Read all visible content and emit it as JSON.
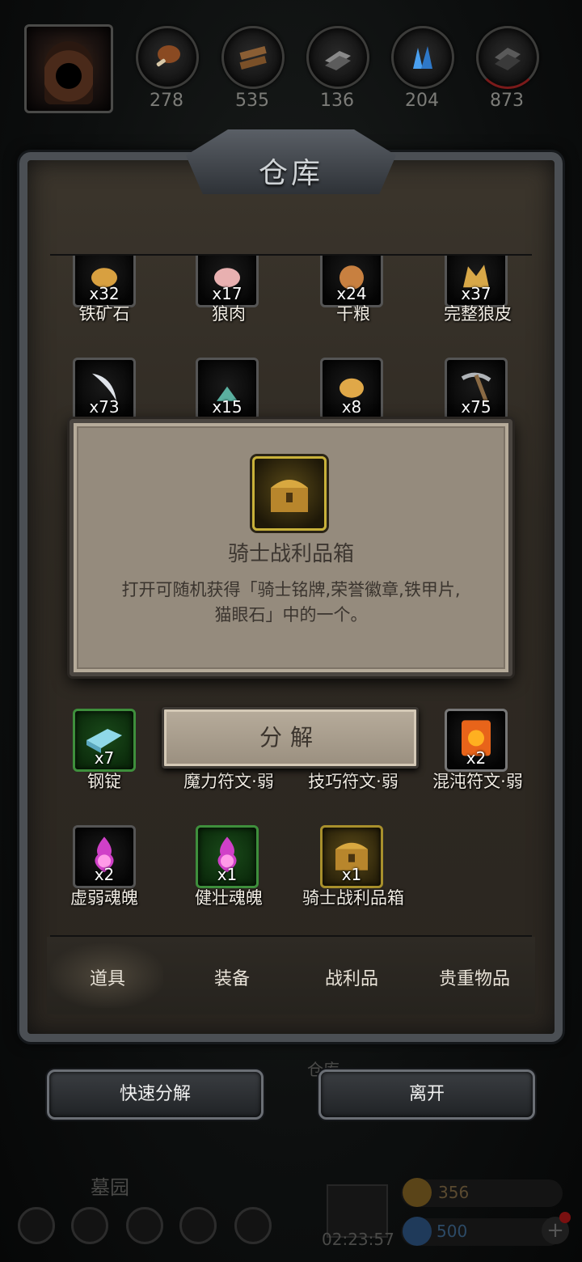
{
  "resources": [
    {
      "name": "meat-icon",
      "value": "278",
      "color": "#8a4a22"
    },
    {
      "name": "wood-icon",
      "value": "535",
      "color": "#8a5e34"
    },
    {
      "name": "iron-icon",
      "value": "136",
      "color": "#7a7a7a"
    },
    {
      "name": "crystal-icon",
      "value": "204",
      "color": "#3a8ad8"
    },
    {
      "name": "ore-icon",
      "value": "873",
      "color": "#5a5a5a"
    }
  ],
  "panel": {
    "title": "仓库"
  },
  "items_row1": [
    {
      "qty": "x32",
      "label": "铁矿石"
    },
    {
      "qty": "x17",
      "label": "狼肉"
    },
    {
      "qty": "x24",
      "label": "干粮"
    },
    {
      "qty": "x37",
      "label": "完整狼皮"
    }
  ],
  "items_row2": [
    {
      "qty": "x73"
    },
    {
      "qty": "x15"
    },
    {
      "qty": "x8"
    },
    {
      "qty": "x75"
    }
  ],
  "items_row3": [
    {
      "qty": "x7",
      "label": "钢锭"
    },
    {
      "label": "魔力符文·弱"
    },
    {
      "label": "技巧符文·弱"
    },
    {
      "qty": "x2",
      "label": "混沌符文·弱"
    }
  ],
  "items_row4": [
    {
      "qty": "x2",
      "label": "虚弱魂魄"
    },
    {
      "qty": "x1",
      "label": "健壮魂魄"
    },
    {
      "qty": "x1",
      "label": "骑士战利品箱"
    }
  ],
  "popup": {
    "name": "骑士战利品箱",
    "desc_line1": "打开可随机获得「骑士铭牌,荣誉徽章,铁甲片,",
    "desc_line2": "猫眼石」中的一个。"
  },
  "decompose_label": "分解",
  "tabs": [
    {
      "label": "道具",
      "active": true
    },
    {
      "label": "装备"
    },
    {
      "label": "战利品"
    },
    {
      "label": "贵重物品"
    }
  ],
  "buttons": {
    "quick_decompose": "快速分解",
    "leave": "离开"
  },
  "hud": {
    "location": "墓园",
    "behind_label": "仓库",
    "timer": "02:23:57",
    "gold": "356",
    "gems": "500"
  }
}
